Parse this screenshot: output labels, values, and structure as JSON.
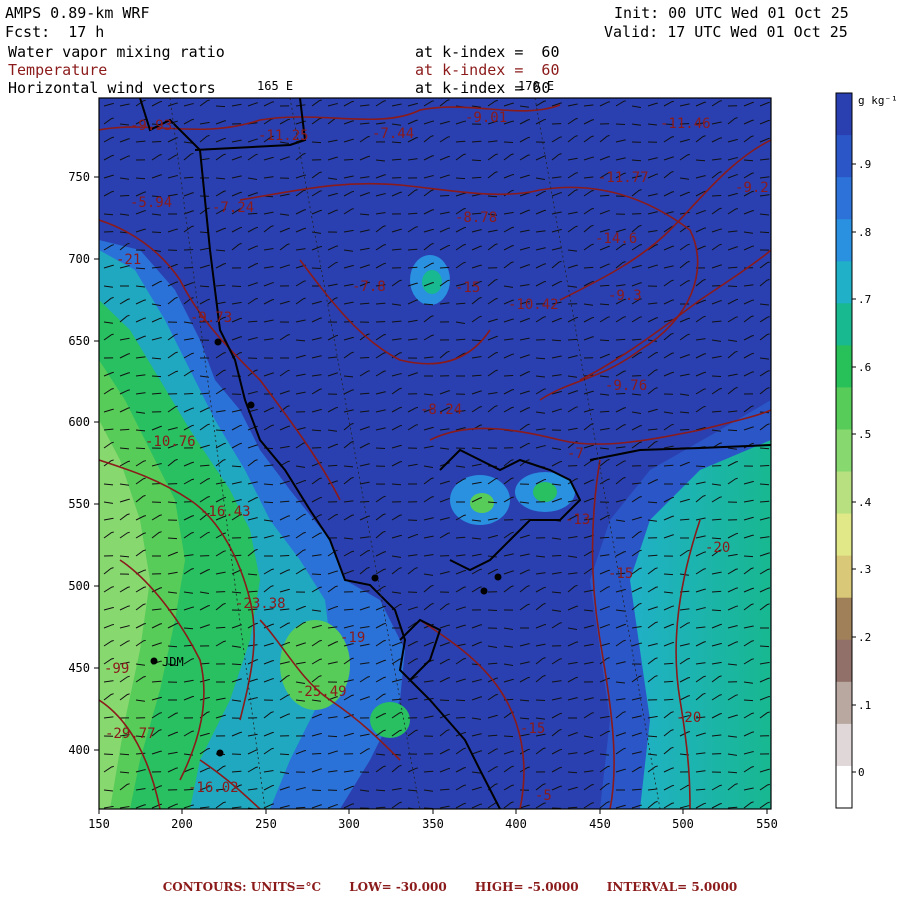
{
  "header": {
    "model": "AMPS 0.89-km WRF",
    "fcst": "Fcst:  17 h",
    "init": "Init: 00 UTC Wed 01 Oct 25",
    "valid": "Valid: 17 UTC Wed 01 Oct 25"
  },
  "fields": [
    {
      "name": "Water vapor mixing ratio",
      "level": "at k-index =  60",
      "color": "#000000"
    },
    {
      "name": "Temperature",
      "level": "at k-index =  60",
      "color": "#8b1a1a"
    },
    {
      "name": "Horizontal wind vectors",
      "level": "at k-index = 60",
      "color": "#000000"
    }
  ],
  "longitudes": [
    "165 E",
    "170 E"
  ],
  "x_ticks": [
    "150",
    "200",
    "250",
    "300",
    "350",
    "400",
    "450",
    "500",
    "550"
  ],
  "y_ticks": [
    "750",
    "700",
    "650",
    "600",
    "550",
    "500",
    "450",
    "400"
  ],
  "colorbar": {
    "unit": "g kg⁻¹",
    "labels": [
      ".9",
      ".8",
      ".7",
      ".6",
      ".5",
      ".4",
      ".3",
      ".2",
      ".1",
      "0"
    ],
    "colors": [
      "#2a40b0",
      "#2a56c8",
      "#2d72d8",
      "#2a90e0",
      "#20b0c8",
      "#18b890",
      "#28c058",
      "#58cc58",
      "#88d870",
      "#b8e080",
      "#e0e888",
      "#d8c878",
      "#a08058",
      "#907068",
      "#b8a8a0",
      "#e0d8d8",
      "#ffffff"
    ]
  },
  "contour_labels": [
    "-9.93",
    "-11.25",
    "-7.44",
    "-9.01",
    "-11.46",
    "-11.77",
    "-9.2",
    "-5.94",
    "-7.24",
    "-8.78",
    "-14.6",
    "-9.3",
    "-21",
    "-7.8",
    "-15",
    "-10.42",
    "-9.73",
    "-8.24",
    "-9.76",
    "-10.76",
    "-7",
    "-16.43",
    "-13",
    "-23.38",
    "-15",
    "-20",
    "-19",
    "-99",
    "-25.49",
    "-20",
    "-29.77",
    "-16.02",
    "-15",
    "-5"
  ],
  "station": "JDM",
  "footer": {
    "contours": "CONTOURS:  UNITS=°C",
    "low": "LOW= -30.000",
    "high": "HIGH= -5.0000",
    "interval": "INTERVAL=   5.0000"
  }
}
